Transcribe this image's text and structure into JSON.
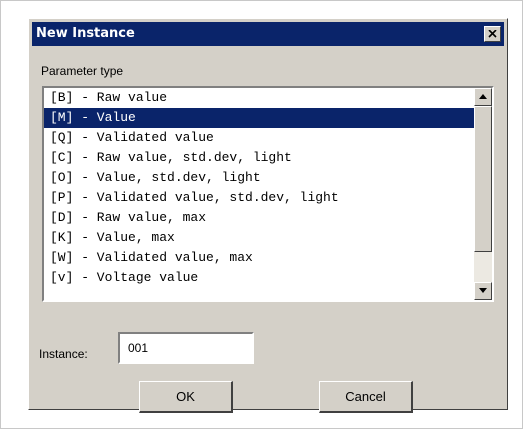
{
  "dialog": {
    "title": "New Instance",
    "close_icon": "close-icon"
  },
  "parameter_type": {
    "label": "Parameter type",
    "selected_index": 1,
    "items": [
      {
        "label": "[B] - Raw value"
      },
      {
        "label": "[M] - Value"
      },
      {
        "label": "[Q] - Validated value"
      },
      {
        "label": "[C] - Raw value, std.dev, light"
      },
      {
        "label": "[O] - Value, std.dev, light"
      },
      {
        "label": "[P] - Validated value, std.dev, light"
      },
      {
        "label": "[D] - Raw value, max"
      },
      {
        "label": "[K] - Value, max"
      },
      {
        "label": "[W] - Validated value, max"
      },
      {
        "label": "[v] - Voltage value"
      }
    ]
  },
  "instance": {
    "label": "Instance:",
    "value": "001"
  },
  "buttons": {
    "ok_label": "OK",
    "cancel_label": "Cancel"
  },
  "colors": {
    "titlebar": "#0a246a",
    "face": "#d4d0c8",
    "selection": "#0a246a"
  }
}
